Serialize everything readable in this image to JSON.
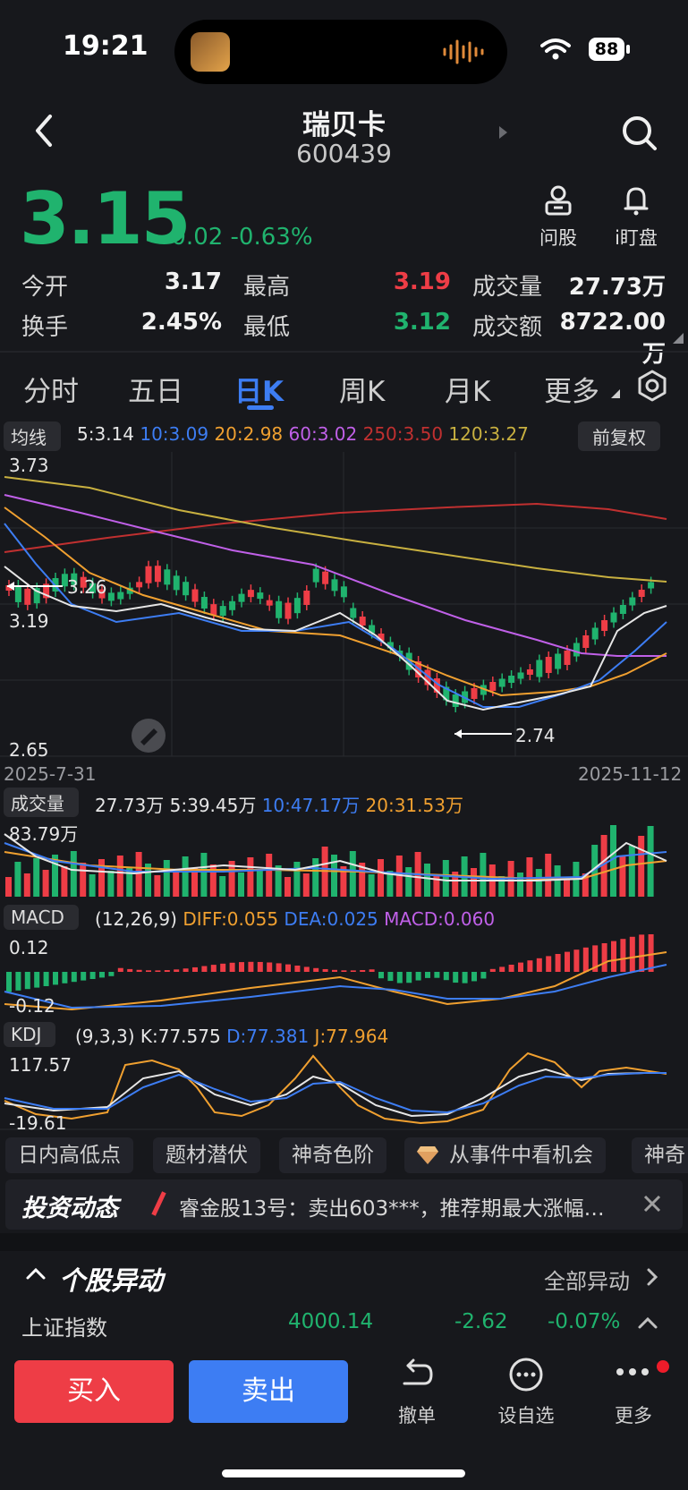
{
  "status": {
    "time": "19:21",
    "battery": "88"
  },
  "header": {
    "name": "瑞贝卡",
    "code": "600439"
  },
  "quote": {
    "price": "3.15",
    "change": "-0.02",
    "change_pct": "-0.63%",
    "ask_label": "问股",
    "watch_label": "i盯盘",
    "stats": [
      {
        "label": "今开",
        "value": "3.17"
      },
      {
        "label": "最高",
        "value": "3.19"
      },
      {
        "label": "成交量",
        "value": "27.73万"
      },
      {
        "label": "换手",
        "value": "2.45%"
      },
      {
        "label": "最低",
        "value": "3.12"
      },
      {
        "label": "成交额",
        "value": "8722.00万"
      }
    ]
  },
  "tabs": [
    "分时",
    "五日",
    "日K",
    "周K",
    "月K",
    "更多"
  ],
  "ma_legend": {
    "label": "均线",
    "items": [
      {
        "text": "5:3.14",
        "color": "#e6e6e6"
      },
      {
        "text": "10:3.09",
        "color": "#3d7df3"
      },
      {
        "text": "20:2.98",
        "color": "#f0a030"
      },
      {
        "text": "60:3.02",
        "color": "#c060e8"
      },
      {
        "text": "250:3.50",
        "color": "#c03030"
      },
      {
        "text": "120:3.27",
        "color": "#c8b040"
      }
    ],
    "adjust": "前复权"
  },
  "main_chart": {
    "y_top": "3.73",
    "y_mid": "3.19",
    "y_bot": "2.65",
    "marker_high": "3.26",
    "marker_low": "2.74",
    "date_start": "2025-7-31",
    "date_end": "2025-11-12"
  },
  "volume": {
    "label": "成交量",
    "items": [
      {
        "text": "27.73万",
        "color": "#e6e6e6"
      },
      {
        "text": "5:39.45万",
        "color": "#e6e6e6"
      },
      {
        "text": "10:47.17万",
        "color": "#3d7df3"
      },
      {
        "text": "20:31.53万",
        "color": "#f0a030"
      }
    ],
    "max": "83.79万"
  },
  "macd": {
    "label": "MACD",
    "params": "(12,26,9)",
    "items": [
      {
        "text": "DIFF:0.055",
        "color": "#f0a030"
      },
      {
        "text": "DEA:0.025",
        "color": "#3d7df3"
      },
      {
        "text": "MACD:0.060",
        "color": "#c060e8"
      }
    ],
    "y_top": "0.12",
    "y_bot": "-0.12"
  },
  "kdj": {
    "label": "KDJ",
    "params": "(9,3,3)",
    "items": [
      {
        "text": "K:77.575",
        "color": "#e6e6e6"
      },
      {
        "text": "D:77.381",
        "color": "#3d7df3"
      },
      {
        "text": "J:77.964",
        "color": "#f0a030"
      }
    ],
    "y_top": "117.57",
    "y_bot": "-19.61"
  },
  "chips": [
    "日内高低点",
    "题材潜伏",
    "神奇色阶",
    "从事件中看机会",
    "神奇"
  ],
  "news": {
    "badge": "投资动态",
    "text": "睿金股13号：卖出603***，推荐期最大涨幅…"
  },
  "movers": {
    "title": "个股异动",
    "all": "全部异动",
    "index_name": "上证指数",
    "index_value": "4000.14",
    "index_change": "-2.62",
    "index_pct": "-0.07%"
  },
  "bottom": {
    "buy": "买入",
    "sell": "卖出",
    "cancel": "撤单",
    "watchlist": "设自选",
    "more": "更多"
  }
}
